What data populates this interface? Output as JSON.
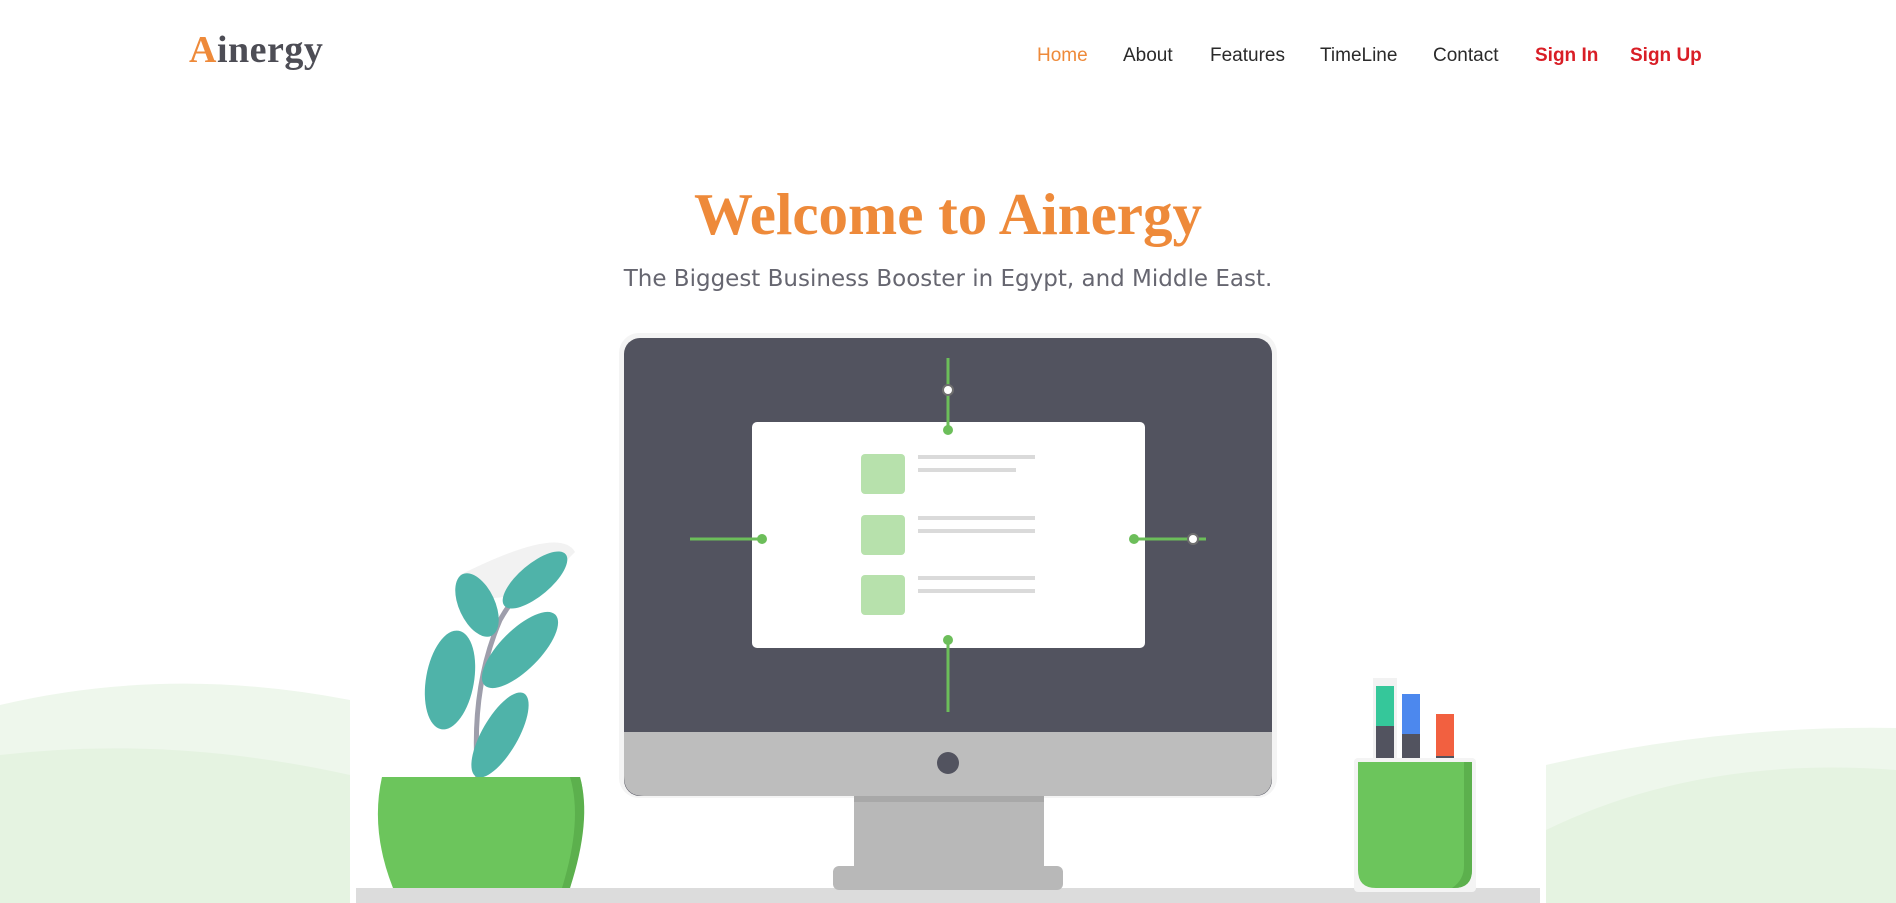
{
  "brand": {
    "first_letter": "A",
    "rest": "inergy"
  },
  "nav": {
    "items": [
      {
        "label": "Home"
      },
      {
        "label": "About"
      },
      {
        "label": "Features"
      },
      {
        "label": "TimeLine"
      },
      {
        "label": "Contact"
      },
      {
        "label": "Sign In"
      },
      {
        "label": "Sign Up"
      }
    ]
  },
  "hero": {
    "title": "Welcome to Ainergy",
    "subtitle": "The Biggest Business Booster in Egypt, and Middle East."
  },
  "illustration": {
    "colors": {
      "accent": "#ee8a3a",
      "monitor_body": "#52535f",
      "monitor_chin": "#bdbdbd",
      "node_green": "#6cbe5a",
      "card_green": "#b7e1ac",
      "leaf_teal": "#4fb3a9",
      "pot_green": "#6cc55c",
      "hill_light": "#eef7ec",
      "hill_mid": "#e5f3e1",
      "marker_teal": "#35c79a",
      "marker_blue": "#4c88ee",
      "marker_red": "#f26040"
    },
    "icons": [
      "plant-icon",
      "monitor-icon",
      "pen-holder-icon"
    ]
  }
}
